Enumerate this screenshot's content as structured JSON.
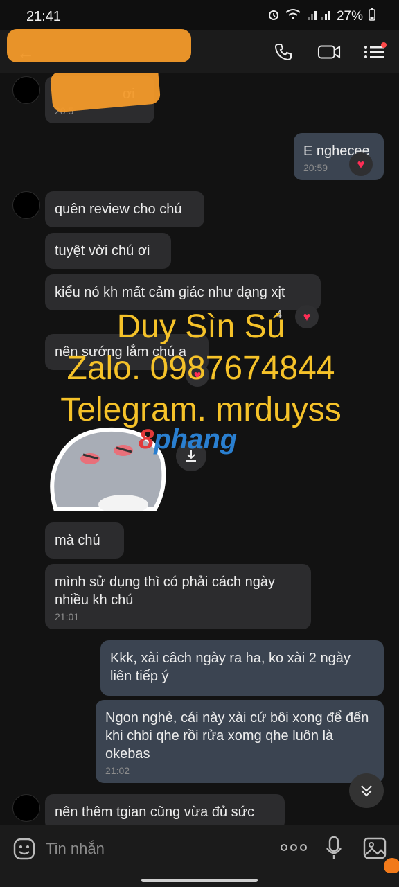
{
  "status_bar": {
    "time": "21:41",
    "battery": "27%"
  },
  "messages": [
    {
      "text": "ơi",
      "time": "20:5"
    },
    {
      "text": "E nghecee",
      "time": "20:59"
    },
    {
      "text": "quên review cho chú"
    },
    {
      "text": "tuyệt vời chú ơi"
    },
    {
      "text": "kiểu nó kh mất cảm giác như dạng xịt",
      "reaction_count": "4"
    },
    {
      "text": "nên sướng lắm chú a"
    },
    {
      "text": "mà chú"
    },
    {
      "text": "mình sử dụng thì có phải cách ngày nhiều kh chú",
      "time": "21:01"
    },
    {
      "text": "Kkk, xài câch ngày ra ha, ko xài 2 ngày liên tiếp ý"
    },
    {
      "text": "Ngon nghẻ, cái này xài cứ bôi xong để đến khi chbi qhe rồi rửa xomg qhe luôn là okebas",
      "time": "21:02"
    },
    {
      "text": "nên thêm tgian cũng vừa đủ sức"
    }
  ],
  "watermark": {
    "line1": "Duy Sìn Sú",
    "line2": "Zalo. 0987674844",
    "line3": "Telegram. mrduyss"
  },
  "logo_text": "phang",
  "input": {
    "placeholder": "Tin nhắn"
  },
  "icons": {
    "heart_color": "#ff2d55",
    "watermark_color": "#f5c229",
    "censor_color": "#f39a2a"
  }
}
